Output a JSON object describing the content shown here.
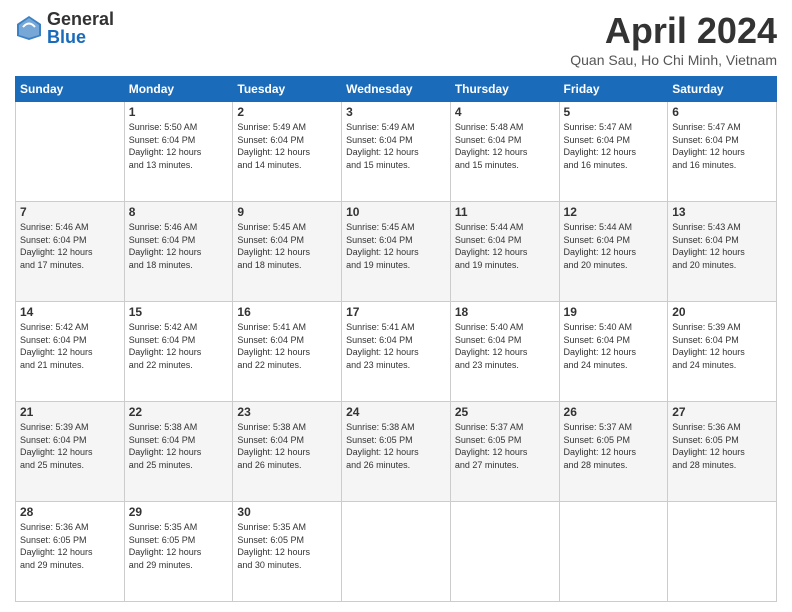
{
  "logo": {
    "general": "General",
    "blue": "Blue"
  },
  "header": {
    "month": "April 2024",
    "location": "Quan Sau, Ho Chi Minh, Vietnam"
  },
  "days": [
    "Sunday",
    "Monday",
    "Tuesday",
    "Wednesday",
    "Thursday",
    "Friday",
    "Saturday"
  ],
  "weeks": [
    [
      {
        "day": "",
        "info": ""
      },
      {
        "day": "1",
        "info": "Sunrise: 5:50 AM\nSunset: 6:04 PM\nDaylight: 12 hours\nand 13 minutes."
      },
      {
        "day": "2",
        "info": "Sunrise: 5:49 AM\nSunset: 6:04 PM\nDaylight: 12 hours\nand 14 minutes."
      },
      {
        "day": "3",
        "info": "Sunrise: 5:49 AM\nSunset: 6:04 PM\nDaylight: 12 hours\nand 15 minutes."
      },
      {
        "day": "4",
        "info": "Sunrise: 5:48 AM\nSunset: 6:04 PM\nDaylight: 12 hours\nand 15 minutes."
      },
      {
        "day": "5",
        "info": "Sunrise: 5:47 AM\nSunset: 6:04 PM\nDaylight: 12 hours\nand 16 minutes."
      },
      {
        "day": "6",
        "info": "Sunrise: 5:47 AM\nSunset: 6:04 PM\nDaylight: 12 hours\nand 16 minutes."
      }
    ],
    [
      {
        "day": "7",
        "info": "Sunrise: 5:46 AM\nSunset: 6:04 PM\nDaylight: 12 hours\nand 17 minutes."
      },
      {
        "day": "8",
        "info": "Sunrise: 5:46 AM\nSunset: 6:04 PM\nDaylight: 12 hours\nand 18 minutes."
      },
      {
        "day": "9",
        "info": "Sunrise: 5:45 AM\nSunset: 6:04 PM\nDaylight: 12 hours\nand 18 minutes."
      },
      {
        "day": "10",
        "info": "Sunrise: 5:45 AM\nSunset: 6:04 PM\nDaylight: 12 hours\nand 19 minutes."
      },
      {
        "day": "11",
        "info": "Sunrise: 5:44 AM\nSunset: 6:04 PM\nDaylight: 12 hours\nand 19 minutes."
      },
      {
        "day": "12",
        "info": "Sunrise: 5:44 AM\nSunset: 6:04 PM\nDaylight: 12 hours\nand 20 minutes."
      },
      {
        "day": "13",
        "info": "Sunrise: 5:43 AM\nSunset: 6:04 PM\nDaylight: 12 hours\nand 20 minutes."
      }
    ],
    [
      {
        "day": "14",
        "info": "Sunrise: 5:42 AM\nSunset: 6:04 PM\nDaylight: 12 hours\nand 21 minutes."
      },
      {
        "day": "15",
        "info": "Sunrise: 5:42 AM\nSunset: 6:04 PM\nDaylight: 12 hours\nand 22 minutes."
      },
      {
        "day": "16",
        "info": "Sunrise: 5:41 AM\nSunset: 6:04 PM\nDaylight: 12 hours\nand 22 minutes."
      },
      {
        "day": "17",
        "info": "Sunrise: 5:41 AM\nSunset: 6:04 PM\nDaylight: 12 hours\nand 23 minutes."
      },
      {
        "day": "18",
        "info": "Sunrise: 5:40 AM\nSunset: 6:04 PM\nDaylight: 12 hours\nand 23 minutes."
      },
      {
        "day": "19",
        "info": "Sunrise: 5:40 AM\nSunset: 6:04 PM\nDaylight: 12 hours\nand 24 minutes."
      },
      {
        "day": "20",
        "info": "Sunrise: 5:39 AM\nSunset: 6:04 PM\nDaylight: 12 hours\nand 24 minutes."
      }
    ],
    [
      {
        "day": "21",
        "info": "Sunrise: 5:39 AM\nSunset: 6:04 PM\nDaylight: 12 hours\nand 25 minutes."
      },
      {
        "day": "22",
        "info": "Sunrise: 5:38 AM\nSunset: 6:04 PM\nDaylight: 12 hours\nand 25 minutes."
      },
      {
        "day": "23",
        "info": "Sunrise: 5:38 AM\nSunset: 6:04 PM\nDaylight: 12 hours\nand 26 minutes."
      },
      {
        "day": "24",
        "info": "Sunrise: 5:38 AM\nSunset: 6:05 PM\nDaylight: 12 hours\nand 26 minutes."
      },
      {
        "day": "25",
        "info": "Sunrise: 5:37 AM\nSunset: 6:05 PM\nDaylight: 12 hours\nand 27 minutes."
      },
      {
        "day": "26",
        "info": "Sunrise: 5:37 AM\nSunset: 6:05 PM\nDaylight: 12 hours\nand 28 minutes."
      },
      {
        "day": "27",
        "info": "Sunrise: 5:36 AM\nSunset: 6:05 PM\nDaylight: 12 hours\nand 28 minutes."
      }
    ],
    [
      {
        "day": "28",
        "info": "Sunrise: 5:36 AM\nSunset: 6:05 PM\nDaylight: 12 hours\nand 29 minutes."
      },
      {
        "day": "29",
        "info": "Sunrise: 5:35 AM\nSunset: 6:05 PM\nDaylight: 12 hours\nand 29 minutes."
      },
      {
        "day": "30",
        "info": "Sunrise: 5:35 AM\nSunset: 6:05 PM\nDaylight: 12 hours\nand 30 minutes."
      },
      {
        "day": "",
        "info": ""
      },
      {
        "day": "",
        "info": ""
      },
      {
        "day": "",
        "info": ""
      },
      {
        "day": "",
        "info": ""
      }
    ]
  ]
}
